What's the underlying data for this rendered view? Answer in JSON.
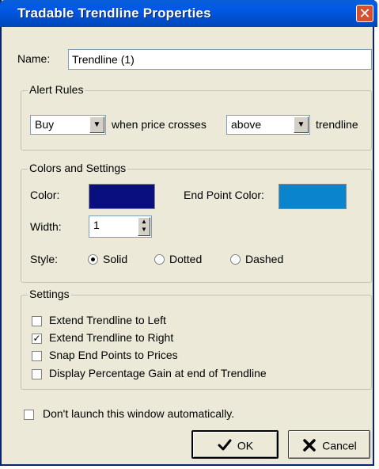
{
  "window": {
    "title": "Tradable Trendline Properties",
    "close_label": "✕"
  },
  "name": {
    "label": "Name:",
    "value": "Trendline (1)"
  },
  "alert_rules": {
    "legend": "Alert Rules",
    "action": "Buy",
    "middle_text": "when price crosses",
    "direction": "above",
    "suffix_text": "trendline"
  },
  "colors": {
    "legend": "Colors and Settings",
    "color_label": "Color:",
    "color_value": "#0a0f80",
    "end_point_label": "End Point Color:",
    "end_point_value": "#0a84cc",
    "width_label": "Width:",
    "width_value": "1",
    "style_label": "Style:",
    "styles": [
      "Solid",
      "Dotted",
      "Dashed"
    ],
    "selected_style": "Solid"
  },
  "settings": {
    "legend": "Settings",
    "options": [
      {
        "label": "Extend Trendline to Left",
        "checked": false
      },
      {
        "label": "Extend Trendline to Right",
        "checked": true
      },
      {
        "label": "Snap End Points to Prices",
        "checked": false
      },
      {
        "label": "Display Percentage Gain at end of Trendline",
        "checked": false
      }
    ]
  },
  "dont_launch": {
    "label": "Don't launch this window automatically.",
    "checked": false
  },
  "buttons": {
    "ok": "OK",
    "cancel": "Cancel"
  }
}
